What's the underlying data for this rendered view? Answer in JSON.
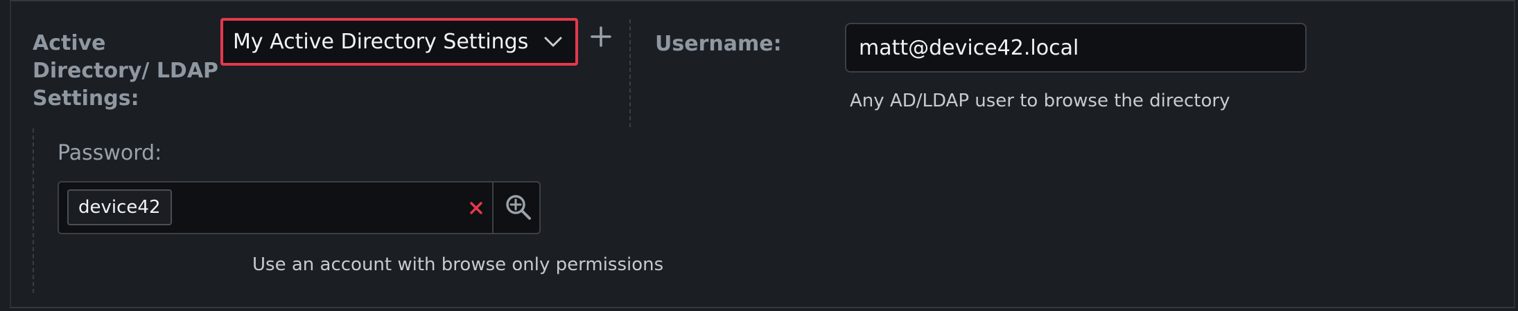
{
  "ad_settings": {
    "label": "Active Directory/ LDAP Settings:",
    "selected": "My Active Directory Settings",
    "chevron_icon": "chevron-down-icon",
    "add_icon": "plus-icon"
  },
  "username": {
    "label": "Username:",
    "value": "matt@device42.local",
    "hint": "Any AD/LDAP user to browse the directory"
  },
  "password": {
    "label": "Password:",
    "value": "device42",
    "clear_icon": "close-icon",
    "browse_icon": "zoom-in-icon",
    "hint": "Use an account with browse only permissions"
  },
  "colors": {
    "background": "#1b1e23",
    "input_background": "#0e1013",
    "highlight_border": "#e5384d",
    "clear_icon": "#e5384d",
    "label": "#8f98a1"
  }
}
